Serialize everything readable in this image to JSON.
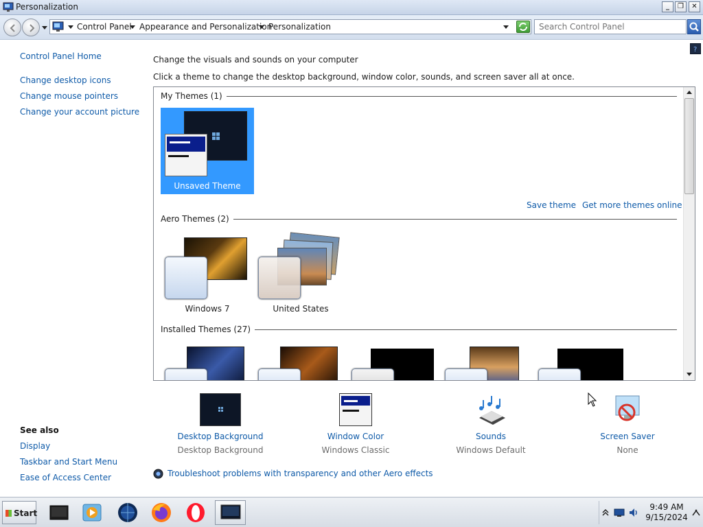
{
  "window": {
    "title": "Personalization",
    "controls": [
      "minimize",
      "restore",
      "close"
    ]
  },
  "toolbar": {
    "breadcrumb": [
      "Control Panel",
      "Appearance and Personalization",
      "Personalization"
    ],
    "search_placeholder": "Search Control Panel"
  },
  "sidebar": {
    "home": "Control Panel Home",
    "links": [
      "Change desktop icons",
      "Change mouse pointers",
      "Change your account picture"
    ],
    "see_also_heading": "See also",
    "see_also": [
      "Display",
      "Taskbar and Start Menu",
      "Ease of Access Center"
    ]
  },
  "main": {
    "heading": "Change the visuals and sounds on your computer",
    "instructions": "Click a theme to change the desktop background, window color, sounds, and screen saver all at once.",
    "groups": {
      "my_themes": {
        "label": "My Themes (1)",
        "themes": [
          "Unsaved Theme"
        ],
        "selected": "Unsaved Theme",
        "actions": [
          "Save theme",
          "Get more themes online"
        ]
      },
      "aero_themes": {
        "label": "Aero Themes (2)",
        "themes": [
          "Windows 7",
          "United States"
        ]
      },
      "installed_themes": {
        "label": "Installed Themes (27)"
      }
    },
    "bottom": [
      {
        "name": "Desktop Background",
        "value": "Desktop Background",
        "icon": "desktop-background-icon"
      },
      {
        "name": "Window Color",
        "value": "Windows Classic",
        "icon": "window-color-icon"
      },
      {
        "name": "Sounds",
        "value": "Windows Default",
        "icon": "sounds-icon"
      },
      {
        "name": "Screen Saver",
        "value": "None",
        "icon": "screen-saver-icon"
      }
    ],
    "troubleshoot": "Troubleshoot problems with transparency and other Aero effects"
  },
  "taskbar": {
    "start": "Start",
    "apps": [
      "desktop-icon",
      "media-player-icon",
      "globe-icon",
      "firefox-icon",
      "opera-icon",
      "personalization-window-icon"
    ],
    "time": "9:49 AM",
    "date": "9/15/2024"
  },
  "colors": {
    "link": "#0e5aa8",
    "selection": "#3399ff"
  }
}
